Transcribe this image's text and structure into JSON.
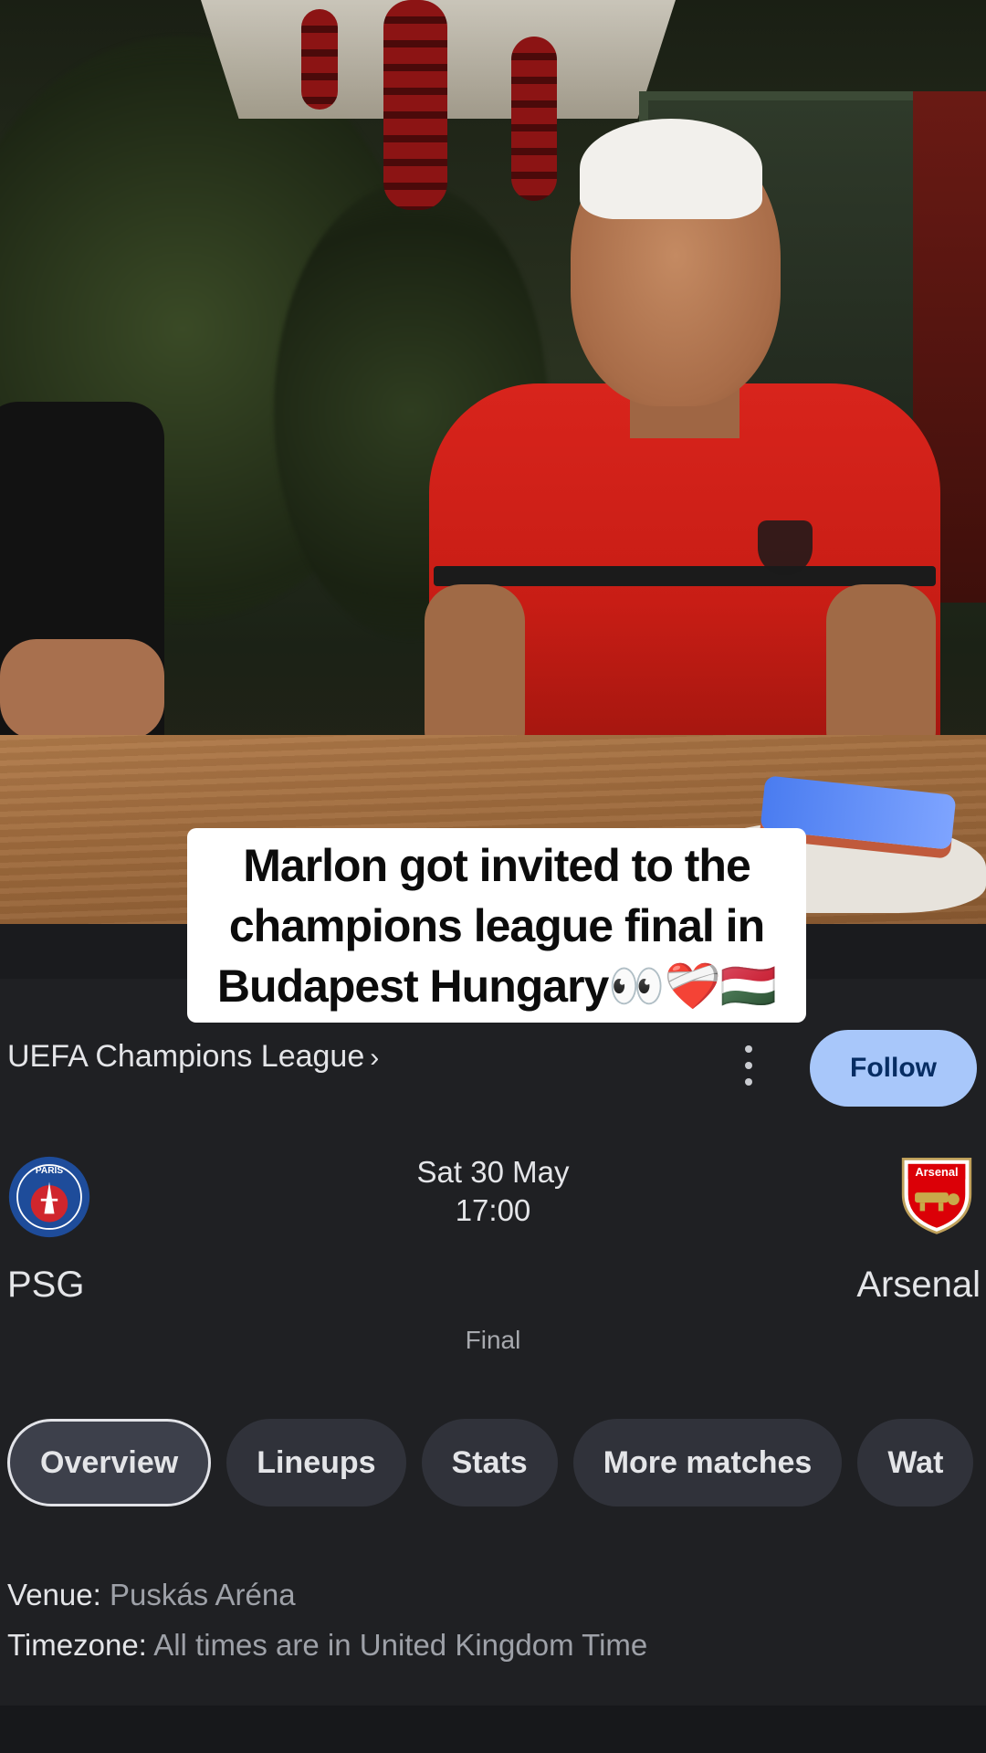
{
  "caption": {
    "text": "Marlon got invited to the champions league final in Budapest Hungary👀❤️‍🩹🇭🇺"
  },
  "match_card": {
    "league": "UEFA Champions League",
    "league_chevron": "›",
    "more_options_icon": "more-vert-icon",
    "follow_label": "Follow",
    "home_team": {
      "name": "PSG",
      "crest_icon": "psg-crest-icon",
      "crest_text": "PARIS"
    },
    "away_team": {
      "name": "Arsenal",
      "crest_icon": "arsenal-crest-icon",
      "crest_text": "Arsenal"
    },
    "date": "Sat 30 May",
    "time": "17:00",
    "stage": "Final",
    "tabs": [
      {
        "label": "Overview",
        "active": true
      },
      {
        "label": "Lineups",
        "active": false
      },
      {
        "label": "Stats",
        "active": false
      },
      {
        "label": "More matches",
        "active": false
      },
      {
        "label": "Wat",
        "active": false
      }
    ],
    "venue_label": "Venue:",
    "venue_value": "Puskás Aréna",
    "timezone_label": "Timezone:",
    "timezone_value": "All times are in United Kingdom Time"
  },
  "colors": {
    "card_background": "#1f2023",
    "follow_button": "#a8c7fa",
    "chip_background": "#30323a",
    "shirt_red": "#d8241c"
  }
}
